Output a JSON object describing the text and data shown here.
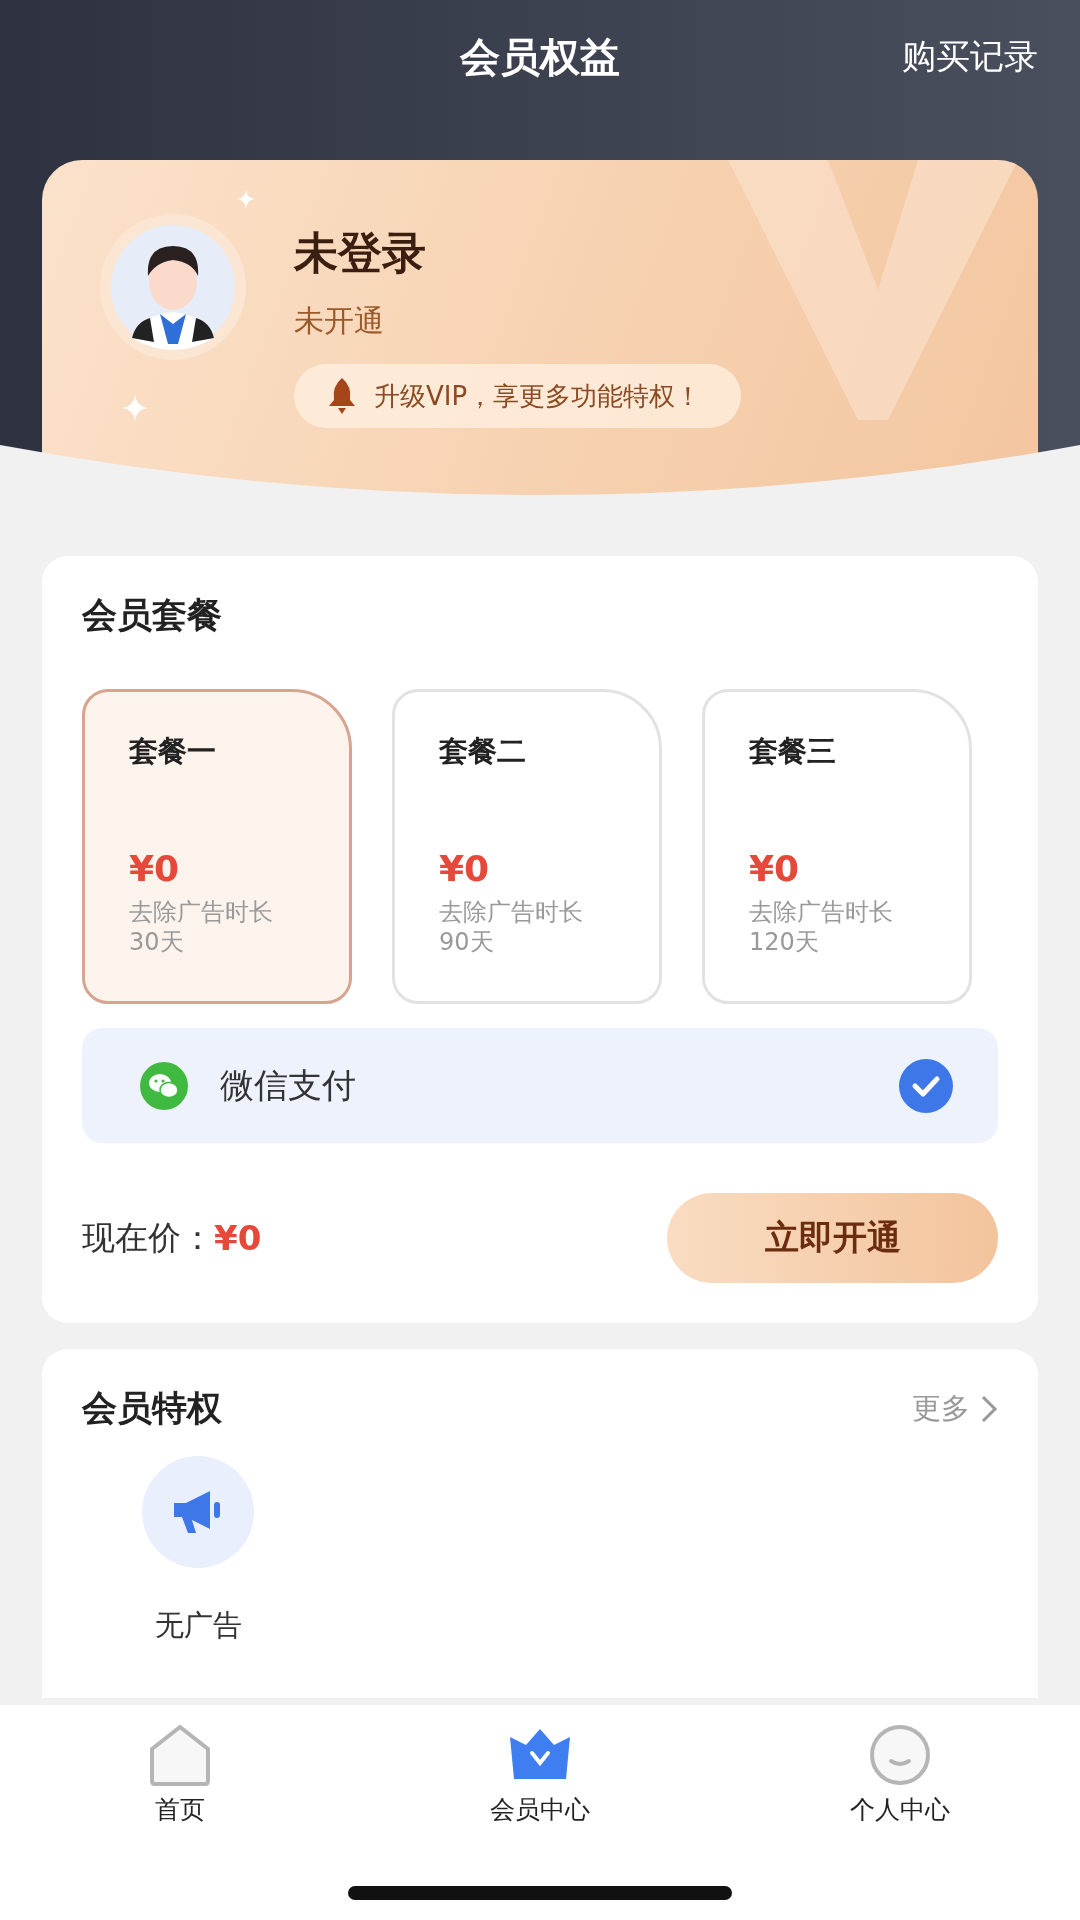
{
  "header": {
    "title": "会员权益",
    "action": "购买记录"
  },
  "profile": {
    "name": "未登录",
    "status": "未开通",
    "promo": "升级VIP，享更多功能特权！"
  },
  "plans_section": {
    "title": "会员套餐",
    "plans": [
      {
        "name": "套餐一",
        "price": "¥0",
        "desc": "去除广告时长",
        "duration": "30天",
        "selected": true
      },
      {
        "name": "套餐二",
        "price": "¥0",
        "desc": "去除广告时长",
        "duration": "90天",
        "selected": false
      },
      {
        "name": "套餐三",
        "price": "¥0",
        "desc": "去除广告时长",
        "duration": "120天",
        "selected": false
      }
    ],
    "payment": {
      "label": "微信支付",
      "selected": true
    },
    "price_label": "现在价：",
    "price": "¥0",
    "button": "立即开通"
  },
  "privileges": {
    "title": "会员特权",
    "more": "更多",
    "items": [
      {
        "label": "无广告"
      }
    ]
  },
  "tab_bar": [
    {
      "label": "首页",
      "kind": "home",
      "selected": false
    },
    {
      "label": "会员中心",
      "kind": "crown",
      "selected": true
    },
    {
      "label": "个人中心",
      "kind": "face",
      "selected": false
    }
  ]
}
